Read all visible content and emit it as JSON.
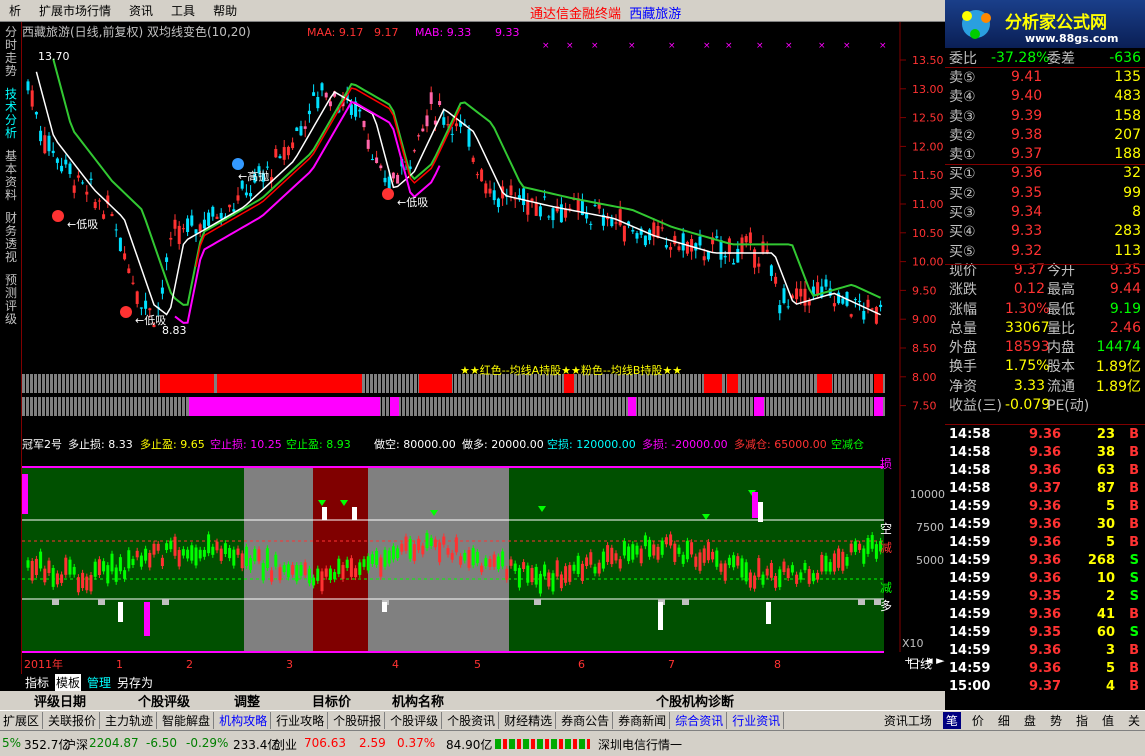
{
  "menu": {
    "items": [
      "析",
      "扩展市场行情",
      "资讯",
      "工具",
      "帮助"
    ],
    "title_a": "通达信金融终端",
    "title_b": "西藏旅游"
  },
  "logo": {
    "name": "分析家公式网",
    "url": "www.88gs.com"
  },
  "lefttabs": [
    "分时走势",
    "技术分析",
    "基本资料",
    "财务透视",
    "预测评级"
  ],
  "chart": {
    "title": "西藏旅游(日线,前复权) 双均线变色(10,20)",
    "maa_label": "MAA: 9.17",
    "maa_v2": "9.17",
    "mab_label": "MAB: 9.33",
    "mab_v2": "9.33",
    "high_label": "13.70",
    "low_label": "8.83",
    "price_ticks": [
      "13.50",
      "13.00",
      "12.50",
      "12.00",
      "11.50",
      "11.00",
      "10.50",
      "10.00",
      "9.50",
      "9.00",
      "8.50",
      "8.00",
      "7.50"
    ],
    "ann": {
      "dixi": "←低吸",
      "gaopao": "←高抛"
    },
    "legend": "★★红色--均线A持股★★粉色--均线B持股★★",
    "ind2": {
      "name": "冠军2号",
      "p1": "多止损: 8.33",
      "p2": "多止盈: 9.65",
      "p3": "空止损: 10.25",
      "p4": "空止盈: 8.93",
      "p5": "做空: 80000.00",
      "p6": "做多: 20000.00",
      "p7": "空损: 120000.00",
      "p8": "多损: -20000.00",
      "p9": "多减仓: 65000.00",
      "p10": "空减仓"
    },
    "ind2_ticks": [
      "10000",
      "7500",
      "5000"
    ],
    "ind2_right": {
      "sun": "损",
      "kong": "空",
      "jian": "减",
      "jian2": "减",
      "duo": "多"
    },
    "x_labels": [
      "2011年",
      "1",
      "2",
      "3",
      "4",
      "5",
      "6",
      "7",
      "8"
    ],
    "x10": "X10",
    "period": "日线",
    "colors": {
      "up": "#ff3232",
      "down": "#00e0ff",
      "maa": "#ff0000",
      "mab": "#ff00ff",
      "ma1": "#ffffff",
      "ma2": "#32c832"
    }
  },
  "quote": {
    "weibi": {
      "label": "委比",
      "val": "-37.28%",
      "label2": "委差",
      "val2": "-636"
    },
    "sell": [
      {
        "n": "卖⑤",
        "p": "9.41",
        "v": "135"
      },
      {
        "n": "卖④",
        "p": "9.40",
        "v": "483"
      },
      {
        "n": "卖③",
        "p": "9.39",
        "v": "158"
      },
      {
        "n": "卖②",
        "p": "9.38",
        "v": "207"
      },
      {
        "n": "卖①",
        "p": "9.37",
        "v": "188"
      }
    ],
    "buy": [
      {
        "n": "买①",
        "p": "9.36",
        "v": "32"
      },
      {
        "n": "买②",
        "p": "9.35",
        "v": "99"
      },
      {
        "n": "买③",
        "p": "9.34",
        "v": "8"
      },
      {
        "n": "买④",
        "p": "9.33",
        "v": "283"
      },
      {
        "n": "买⑤",
        "p": "9.32",
        "v": "113"
      }
    ],
    "info": [
      {
        "l1": "现价",
        "v1": "9.37",
        "l2": "今开",
        "v2": "9.35"
      },
      {
        "l1": "涨跌",
        "v1": "0.12",
        "l2": "最高",
        "v2": "9.44"
      },
      {
        "l1": "涨幅",
        "v1": "1.30%",
        "l2": "最低",
        "v2": "9.19"
      },
      {
        "l1": "总量",
        "v1": "33067",
        "l2": "量比",
        "v2": "2.46"
      },
      {
        "l1": "外盘",
        "v1": "18593",
        "l2": "内盘",
        "v2": "14474"
      },
      {
        "l1": "换手",
        "v1": "1.75%",
        "l2": "股本",
        "v2": "1.89亿"
      },
      {
        "l1": "净资",
        "v1": "3.33",
        "l2": "流通",
        "v2": "1.89亿"
      },
      {
        "l1": "收益(三)",
        "v1": "-0.079",
        "l2": "PE(动)",
        "v2": ""
      }
    ]
  },
  "ticks": [
    {
      "t": "14:58",
      "p": "9.36",
      "v": "23",
      "d": "B"
    },
    {
      "t": "14:58",
      "p": "9.36",
      "v": "38",
      "d": "B"
    },
    {
      "t": "14:58",
      "p": "9.36",
      "v": "63",
      "d": "B"
    },
    {
      "t": "14:58",
      "p": "9.37",
      "v": "87",
      "d": "B"
    },
    {
      "t": "14:59",
      "p": "9.36",
      "v": "5",
      "d": "B"
    },
    {
      "t": "14:59",
      "p": "9.36",
      "v": "30",
      "d": "B"
    },
    {
      "t": "14:59",
      "p": "9.36",
      "v": "5",
      "d": "B"
    },
    {
      "t": "14:59",
      "p": "9.36",
      "v": "268",
      "d": "S"
    },
    {
      "t": "14:59",
      "p": "9.36",
      "v": "10",
      "d": "S"
    },
    {
      "t": "14:59",
      "p": "9.35",
      "v": "2",
      "d": "S"
    },
    {
      "t": "14:59",
      "p": "9.36",
      "v": "41",
      "d": "B"
    },
    {
      "t": "14:59",
      "p": "9.35",
      "v": "60",
      "d": "S"
    },
    {
      "t": "14:59",
      "p": "9.36",
      "v": "3",
      "d": "B"
    },
    {
      "t": "14:59",
      "p": "9.36",
      "v": "5",
      "d": "B"
    },
    {
      "t": "15:00",
      "p": "9.37",
      "v": "4",
      "d": "B"
    }
  ],
  "btm1": {
    "a": "指标",
    "b": "模板",
    "c": "管理",
    "d": "另存为"
  },
  "btm2": {
    "a": "评级日期",
    "b": "个股评级",
    "c": "调整",
    "d": "目标价",
    "e": "机构名称",
    "f": "个股机构诊断"
  },
  "btm3": [
    "扩展区",
    "关联报价",
    "主力轨迹",
    "智能解盘",
    "机构攻略",
    "行业攻略",
    "个股研报",
    "个股评级",
    "个股资讯",
    "财经精选",
    "券商公告",
    "券商新闻",
    "综合资讯",
    "行业资讯"
  ],
  "btm3_right": [
    "资讯工场",
    "笔",
    "价",
    "细",
    "盘",
    "势",
    "指",
    "值",
    "关"
  ],
  "status": {
    "s1": "5%",
    "s2": "352.7亿",
    "s3": "沪深",
    "s4": "2204.87",
    "s5": "-6.50",
    "s6": "-0.29%",
    "s7": "233.4亿",
    "s8": "创业",
    "s9": "706.63",
    "s10": "2.59",
    "s11": "0.37%",
    "s12": "84.90亿",
    "s13": "深圳电信行情一"
  }
}
